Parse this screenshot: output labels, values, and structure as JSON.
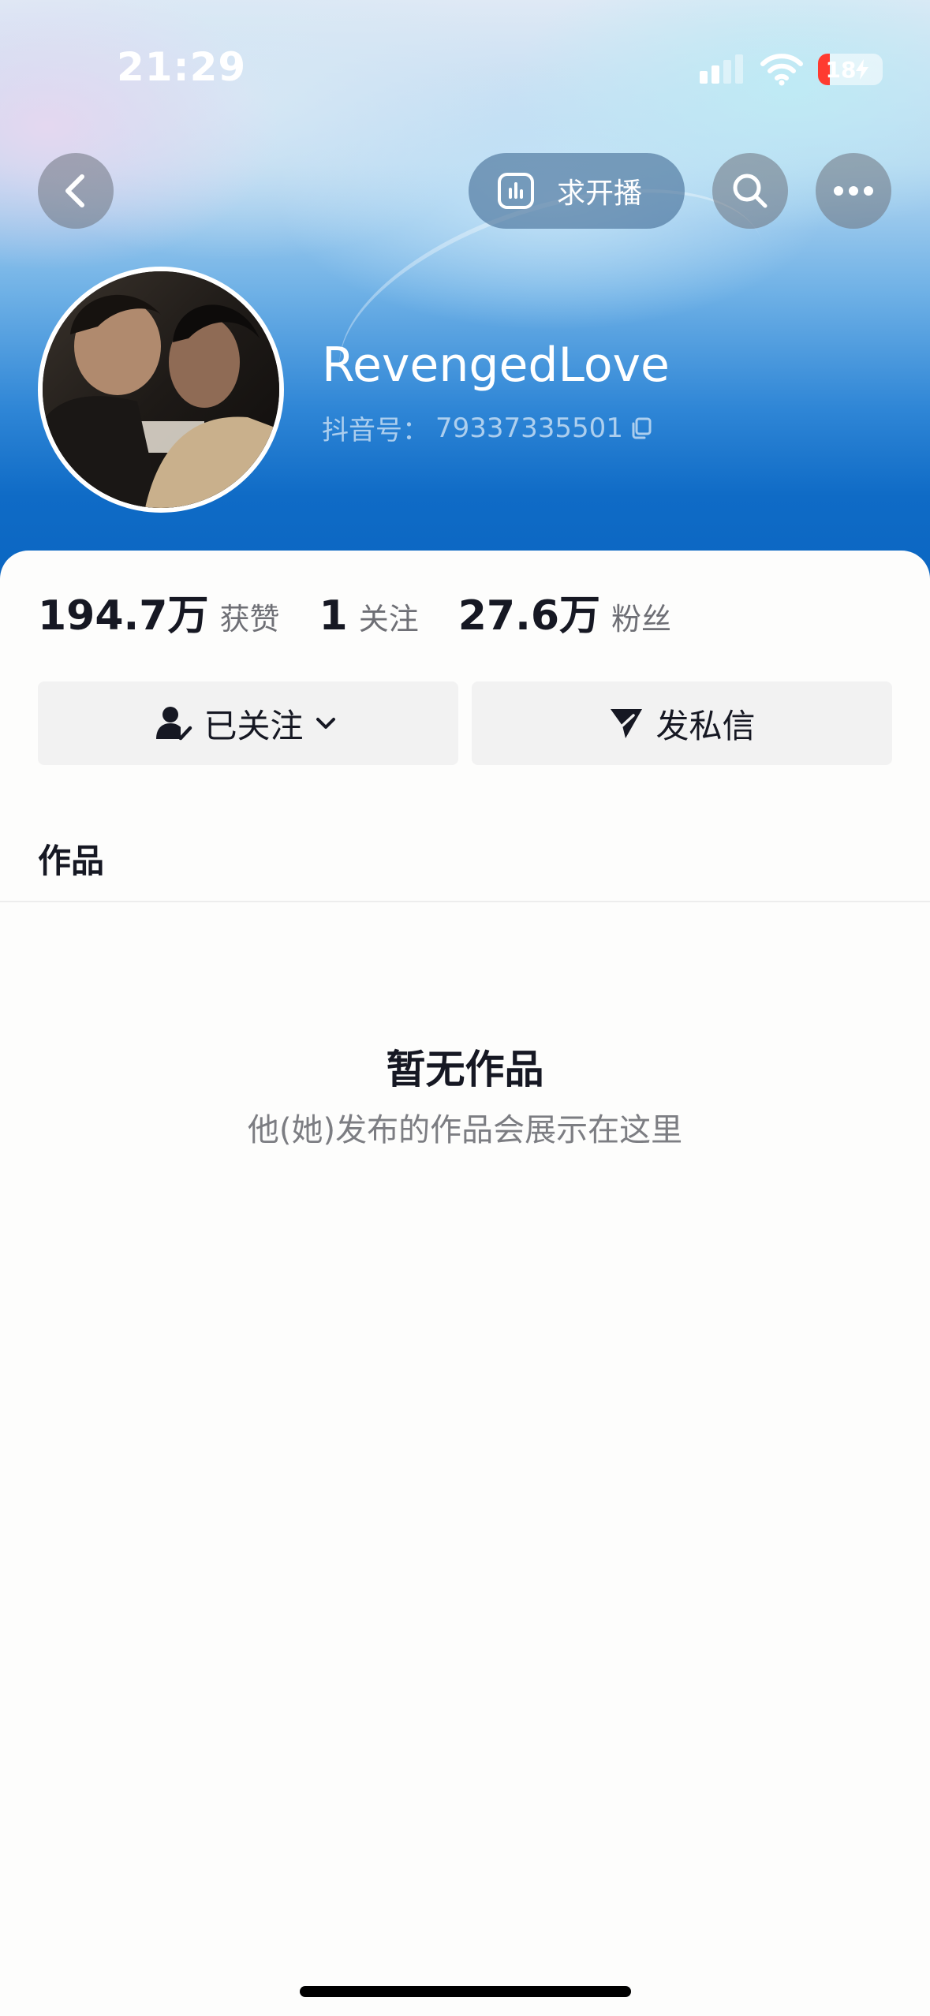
{
  "status_bar": {
    "time": "21:29",
    "battery_level": "18",
    "battery_fraction": 0.18,
    "battery_color": "#ff3b30",
    "icons": [
      "signal-icon",
      "wifi-icon",
      "battery-charging-icon"
    ]
  },
  "nav": {
    "back_icon": "chevron-left-icon",
    "live_request_label": "求开播",
    "live_request_icon": "bar-chart-icon",
    "search_icon": "search-icon",
    "more_icon": "more-dots-icon"
  },
  "profile": {
    "name": "RevengedLove",
    "account_id_label": "抖音号：",
    "account_id": "79337335501",
    "copy_icon": "copy-icon"
  },
  "stats": [
    {
      "value": "194.7万",
      "label": "获赞"
    },
    {
      "value": "1",
      "label": "关注"
    },
    {
      "value": "27.6万",
      "label": "粉丝"
    }
  ],
  "actions": {
    "follow_label": "已关注",
    "follow_icon": "user-check-icon",
    "message_label": "发私信",
    "message_icon": "send-icon"
  },
  "tabs": {
    "works_label": "作品"
  },
  "empty_state": {
    "title": "暂无作品",
    "description": "他(她)发布的作品会展示在这里"
  },
  "colors": {
    "header_blue": "#0b66c2",
    "text_primary": "#161823",
    "text_secondary": "#6e6f75",
    "button_bg": "#f2f2f2"
  }
}
